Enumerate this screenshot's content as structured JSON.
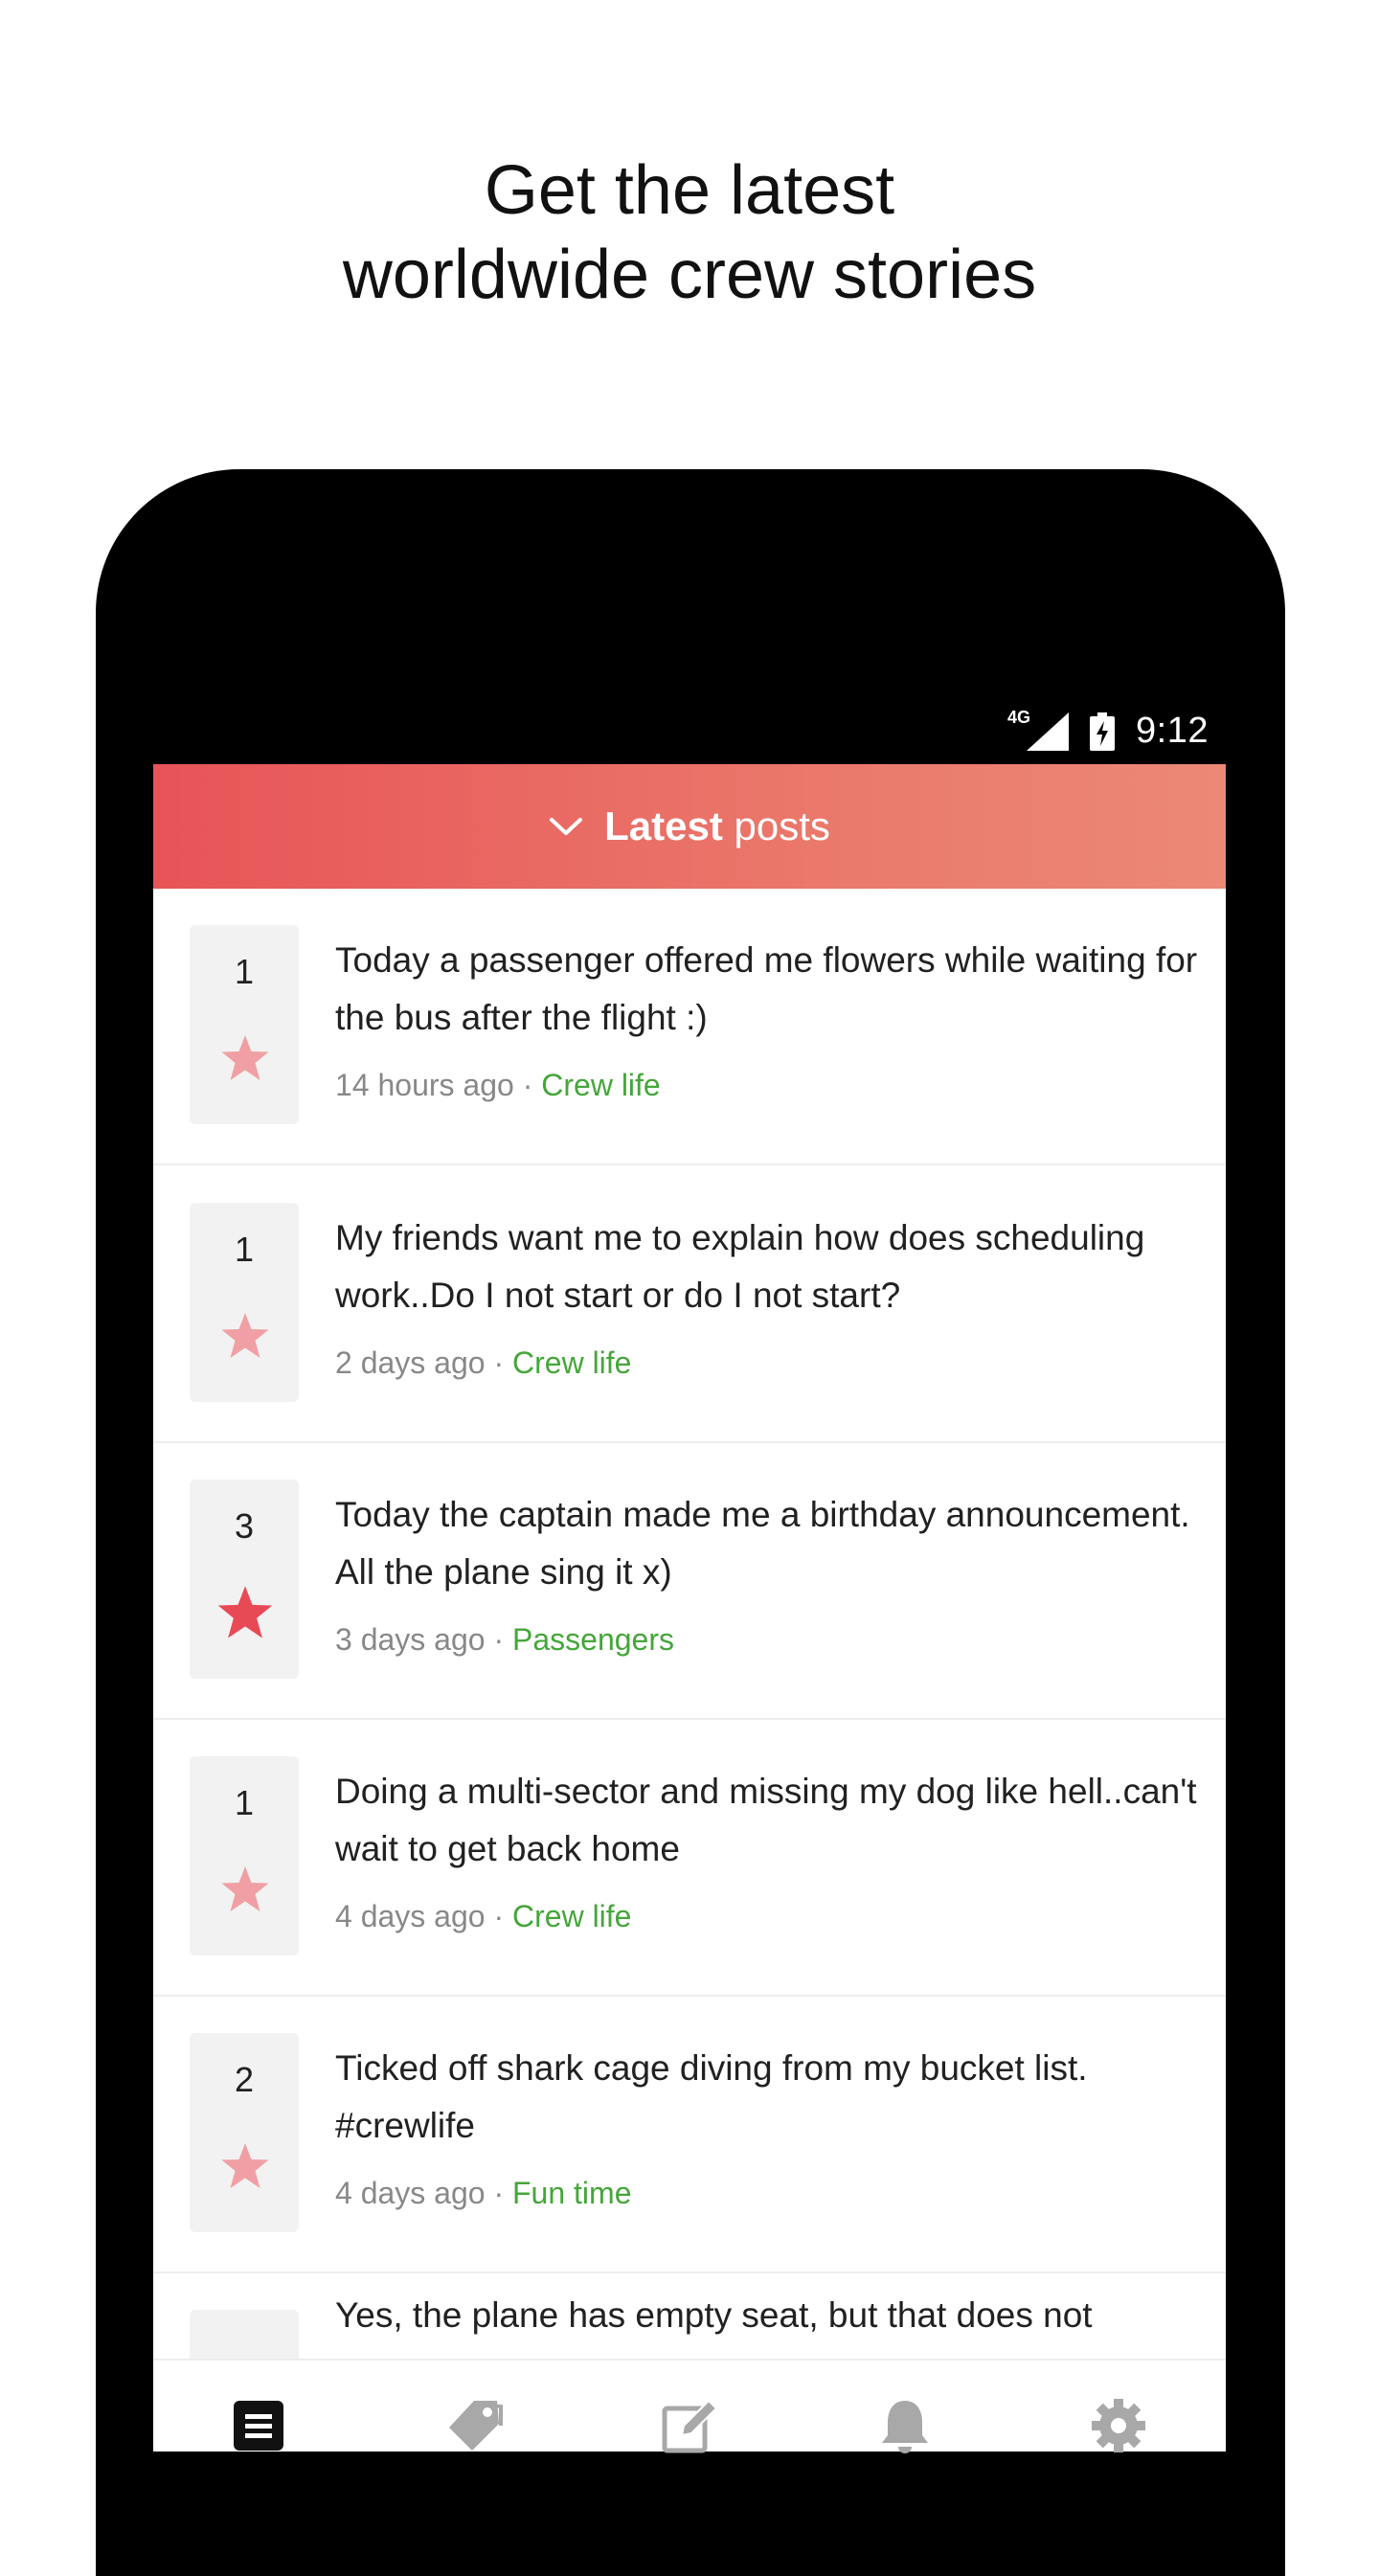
{
  "headline": {
    "line1": "Get the latest",
    "line2": "worldwide crew stories"
  },
  "status_bar": {
    "network": "4G",
    "time": "9:12"
  },
  "app_bar": {
    "title_bold": "Latest",
    "title_light": "posts"
  },
  "posts": [
    {
      "votes": "1",
      "starred": false,
      "text": "Today a passenger offered me flowers while waiting for the bus after the flight :)",
      "time": "14 hours ago",
      "separator": " · ",
      "category": "Crew life"
    },
    {
      "votes": "1",
      "starred": false,
      "text": "My friends want me to explain how does scheduling work..Do I not start or do I not start?",
      "time": "2 days ago",
      "separator": " · ",
      "category": "Crew life"
    },
    {
      "votes": "3",
      "starred": true,
      "text": "Today the captain made me a birthday announcement. All the plane sing it x)",
      "time": "3 days ago",
      "separator": " · ",
      "category": "Passengers"
    },
    {
      "votes": "1",
      "starred": false,
      "text": "Doing a multi-sector and missing my dog like hell..can't wait to get back home",
      "time": "4 days ago",
      "separator": " · ",
      "category": "Crew life"
    },
    {
      "votes": "2",
      "starred": false,
      "text": "Ticked off shark cage diving from my bucket list. #crewlife",
      "time": "4 days ago",
      "separator": " · ",
      "category": "Fun time"
    },
    {
      "text": "Yes, the plane has empty seat, but that does not"
    }
  ],
  "bottom_nav": [
    {
      "icon": "feed-icon",
      "active": true
    },
    {
      "icon": "tags-icon",
      "active": false
    },
    {
      "icon": "compose-icon",
      "active": false
    },
    {
      "icon": "bell-icon",
      "active": false
    },
    {
      "icon": "gear-icon",
      "active": false
    }
  ],
  "colors": {
    "accent_start": "#e85458",
    "accent_end": "#ec8876",
    "star_active": "#e84a55",
    "star_inactive": "#f0a0a4",
    "category": "#45a63a",
    "meta": "#888888"
  }
}
